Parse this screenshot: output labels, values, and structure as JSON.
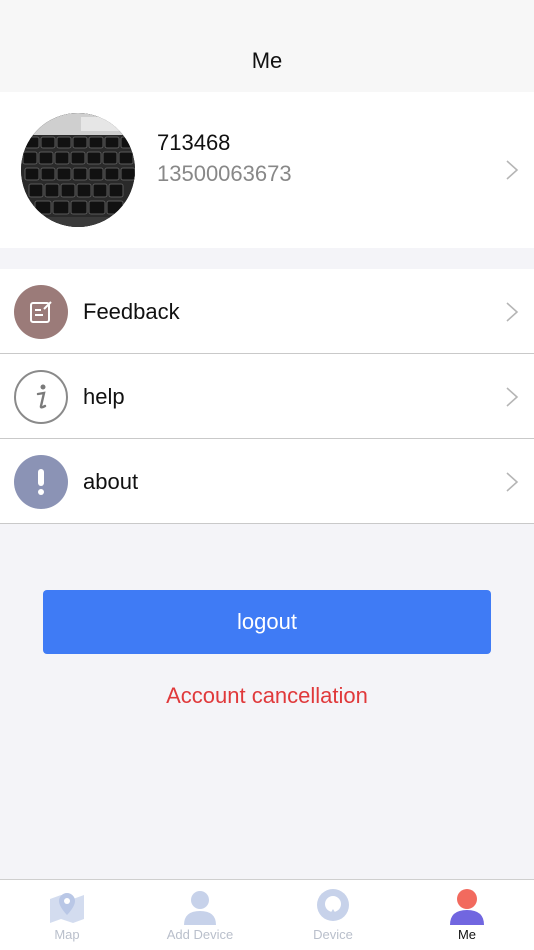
{
  "header": {
    "title": "Me"
  },
  "profile": {
    "username": "713468",
    "phone": "13500063673",
    "avatar_icon": "keyboard-photo"
  },
  "menu": {
    "items": [
      {
        "label": "Feedback",
        "icon": "feedback-icon",
        "color": "#9b7b79"
      },
      {
        "label": "help",
        "icon": "info-icon",
        "color": "#ffffff"
      },
      {
        "label": "about",
        "icon": "exclamation-icon",
        "color": "#8b93b5"
      }
    ]
  },
  "actions": {
    "logout_label": "logout",
    "cancel_label": "Account cancellation"
  },
  "tabbar": {
    "tabs": [
      {
        "label": "Map",
        "icon": "map-icon",
        "active": false
      },
      {
        "label": "Add Device",
        "icon": "add-device-icon",
        "active": false
      },
      {
        "label": "Device",
        "icon": "device-icon",
        "active": false
      },
      {
        "label": "Me",
        "icon": "me-icon",
        "active": true
      }
    ]
  },
  "colors": {
    "accent": "#3f7bf5",
    "danger": "#e0393b",
    "inactive_tab": "#b9bfcb"
  }
}
